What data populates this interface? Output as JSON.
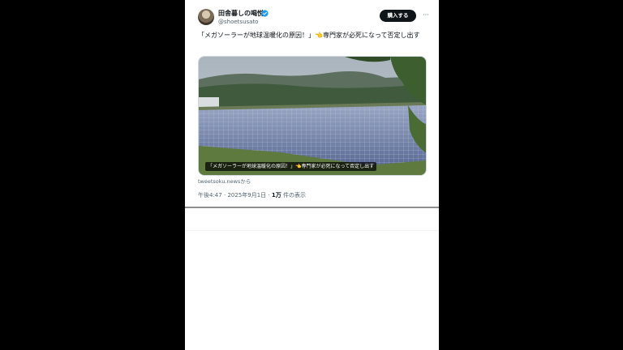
{
  "tweet": {
    "display_name": "田舎暮しの喝悦",
    "handle": "@shoetsusato",
    "buy_label": "購入する",
    "more_label": "···",
    "text": "「メガソーラーが地球温暖化の原因！」👈専門家が必死になって否定し出す",
    "card": {
      "caption": "「メガソーラーが地球温暖化の原因！」👈専門家が必死になって否定し出す",
      "source": "tweetsoku.newsから"
    },
    "meta": {
      "time": "午後4:47",
      "separator": "·",
      "date": "2025年9月1日",
      "views_count": "1万",
      "views_label": "件の表示"
    }
  },
  "colors": {
    "background": "#000000",
    "panel": "#ffffff",
    "text": "#0f1419",
    "secondary": "#536471",
    "verified": "#1d9bf0"
  },
  "icons": {
    "verified": "verified-badge-icon",
    "more": "more-horizontal-icon"
  }
}
